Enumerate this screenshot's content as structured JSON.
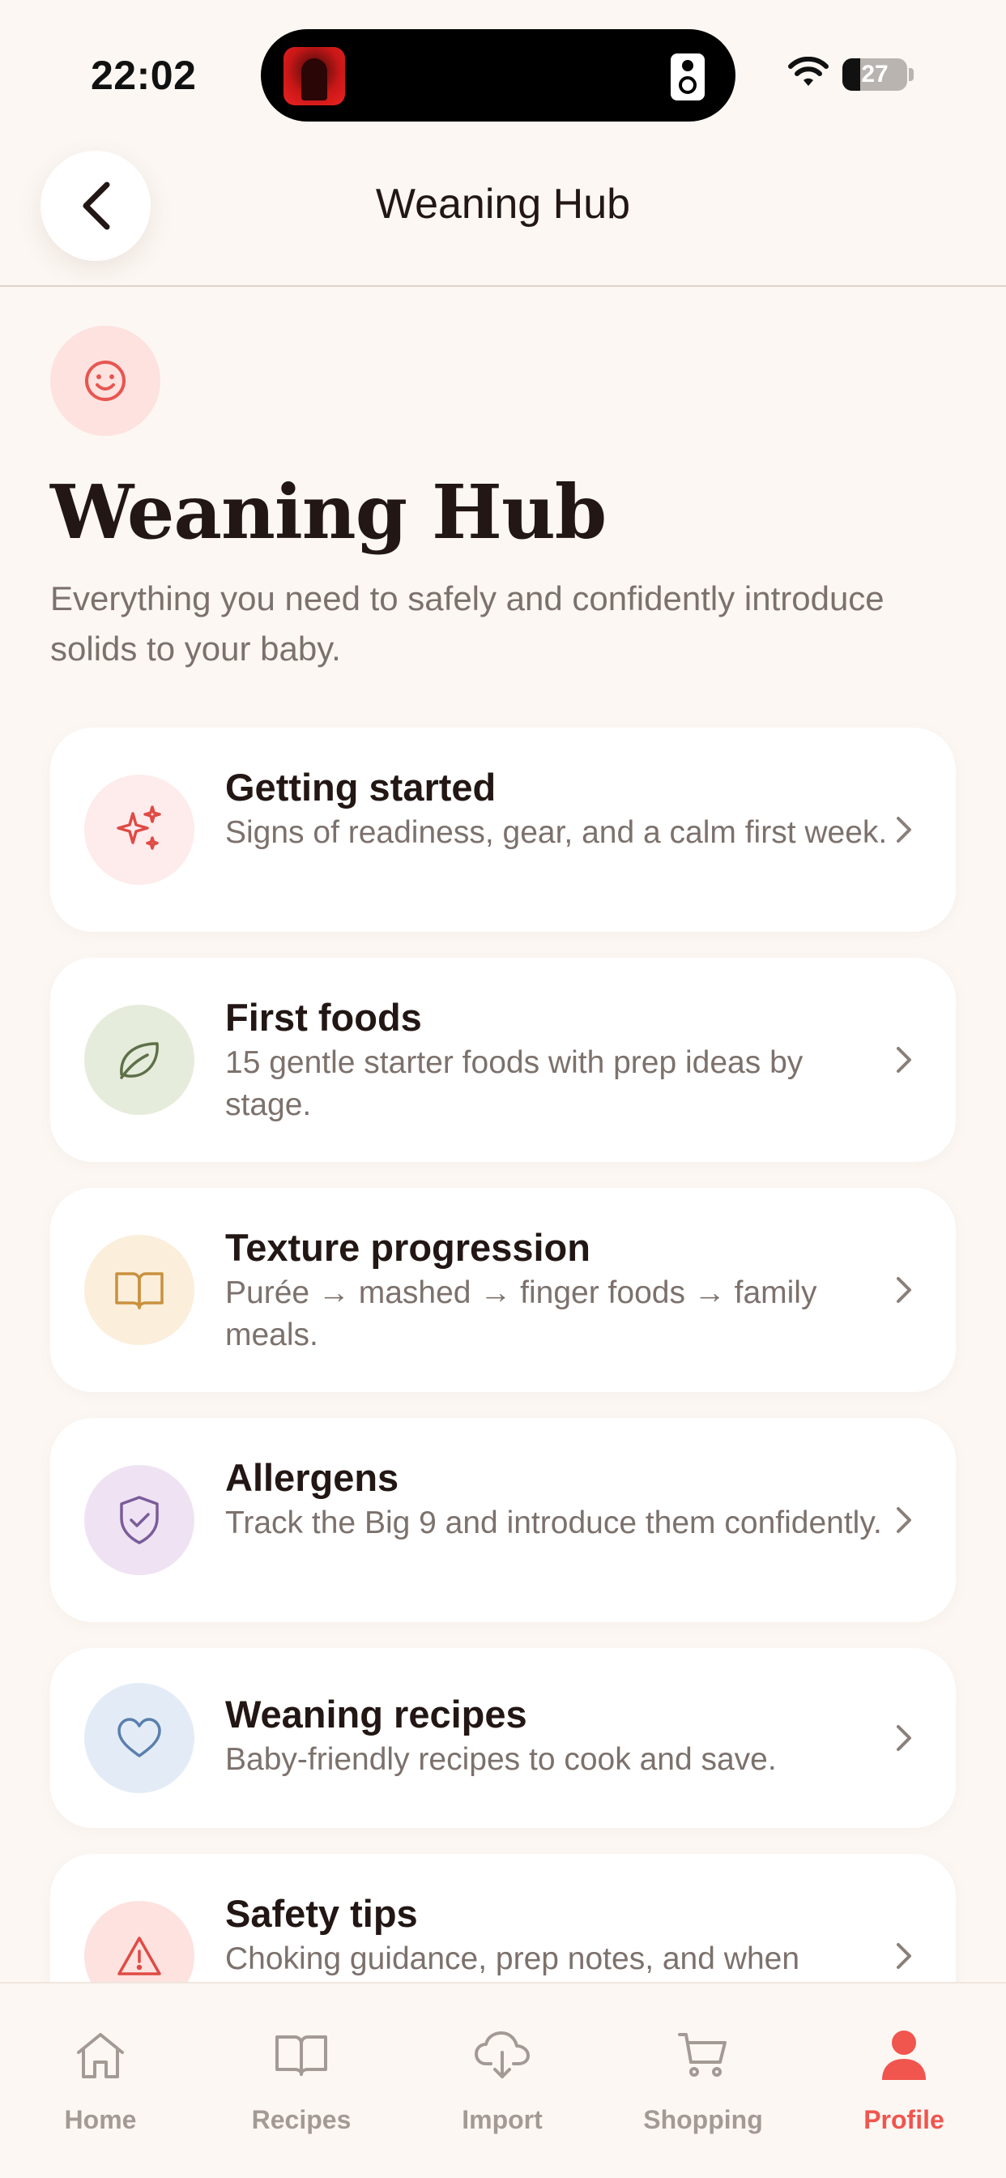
{
  "status_bar": {
    "time": "22:02",
    "battery": "27"
  },
  "header": {
    "title": "Weaning Hub"
  },
  "hero": {
    "title": "Weaning Hub",
    "subtitle": "Everything you need to safely and confidently introduce solids to your baby."
  },
  "cards": [
    {
      "title": "Getting started",
      "desc": "Signs of readiness, gear, and a calm first week.",
      "icon": "sparkles-icon",
      "color": "#e04a45",
      "bg": "#fdeceb"
    },
    {
      "title": "First foods",
      "desc": "15 gentle starter foods with prep ideas by stage.",
      "icon": "leaf-icon",
      "color": "#5e7048",
      "bg": "#e6ecdc"
    },
    {
      "title": "Texture progression",
      "desc": "Purée → mashed → finger foods → family meals.",
      "icon": "book-icon",
      "color": "#c9903e",
      "bg": "#fbeedb"
    },
    {
      "title": "Allergens",
      "desc": "Track the Big 9 and introduce them confidently.",
      "icon": "shield-check-icon",
      "color": "#7b5c9a",
      "bg": "#efe3f3"
    },
    {
      "title": "Weaning recipes",
      "desc": "Baby-friendly recipes to cook and save.",
      "icon": "heart-icon",
      "color": "#5a7fae",
      "bg": "#e3ecf6"
    },
    {
      "title": "Safety tips",
      "desc": "Choking guidance, prep notes, and when",
      "icon": "warning-icon",
      "color": "#e04a45",
      "bg": "#fde2df"
    }
  ],
  "tabs": [
    {
      "label": "Home",
      "icon": "home-icon"
    },
    {
      "label": "Recipes",
      "icon": "book-icon"
    },
    {
      "label": "Import",
      "icon": "cloud-download-icon"
    },
    {
      "label": "Shopping",
      "icon": "cart-icon"
    },
    {
      "label": "Profile",
      "icon": "person-icon",
      "active": true
    }
  ],
  "colors": {
    "accent": "#f0554e",
    "background": "#fcf7f3",
    "text_primary": "#221714",
    "text_secondary": "#7c716c"
  }
}
